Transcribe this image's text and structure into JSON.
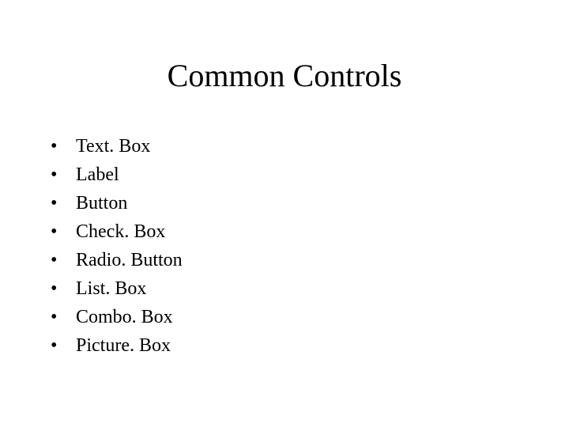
{
  "title": "Common Controls",
  "items": [
    "Text. Box",
    "Label",
    "Button",
    "Check. Box",
    "Radio. Button",
    "List. Box",
    "Combo. Box",
    "Picture. Box"
  ]
}
